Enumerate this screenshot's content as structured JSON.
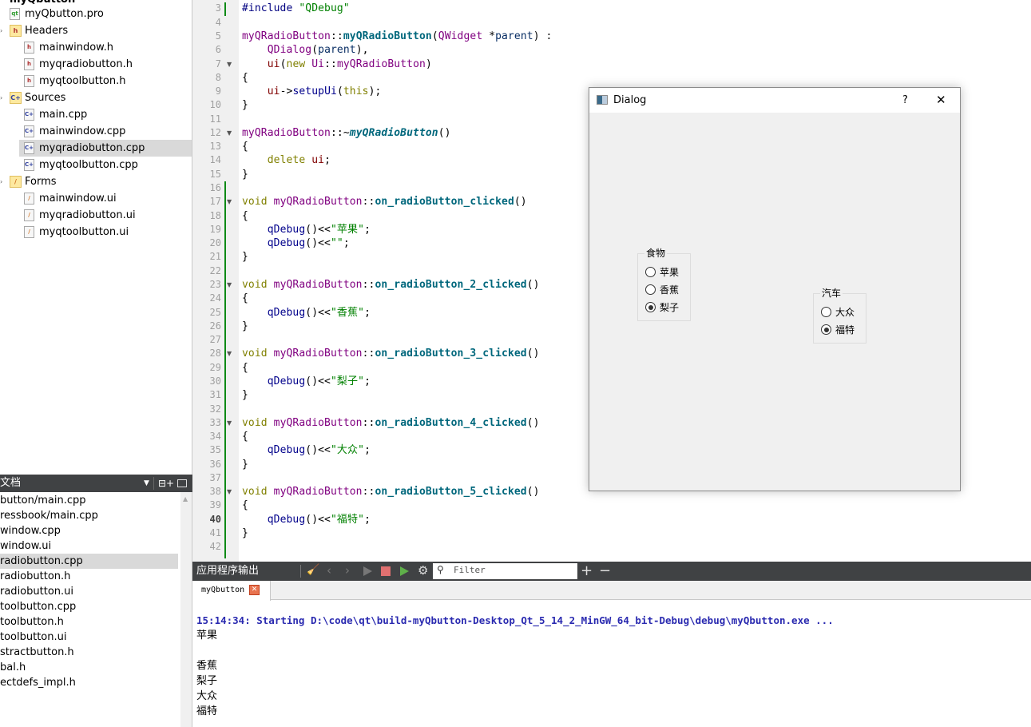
{
  "project_tree": {
    "root": "myQbutton",
    "items": [
      {
        "label": "myQbutton.pro",
        "icon": "qt-project-file-icon",
        "kind": "file",
        "badge": "qt"
      },
      {
        "label": "Headers",
        "icon": "headers-folder-icon",
        "kind": "folder",
        "badge": "h"
      },
      {
        "label": "mainwindow.h",
        "icon": "header-file-icon",
        "kind": "file",
        "badge": "h"
      },
      {
        "label": "myqradiobutton.h",
        "icon": "header-file-icon",
        "kind": "file",
        "badge": "h"
      },
      {
        "label": "myqtoolbutton.h",
        "icon": "header-file-icon",
        "kind": "file",
        "badge": "h"
      },
      {
        "label": "Sources",
        "icon": "sources-folder-icon",
        "kind": "folder",
        "badge": "C+"
      },
      {
        "label": "main.cpp",
        "icon": "cpp-file-icon",
        "kind": "file",
        "badge": "C+"
      },
      {
        "label": "mainwindow.cpp",
        "icon": "cpp-file-icon",
        "kind": "file",
        "badge": "C+"
      },
      {
        "label": "myqradiobutton.cpp",
        "icon": "cpp-file-icon",
        "kind": "file",
        "badge": "C+",
        "selected": true
      },
      {
        "label": "myqtoolbutton.cpp",
        "icon": "cpp-file-icon",
        "kind": "file",
        "badge": "C+"
      },
      {
        "label": "Forms",
        "icon": "forms-folder-icon",
        "kind": "folder",
        "badge": "/"
      },
      {
        "label": "mainwindow.ui",
        "icon": "ui-file-icon",
        "kind": "file",
        "badge": "/"
      },
      {
        "label": "myqradiobutton.ui",
        "icon": "ui-file-icon",
        "kind": "file",
        "badge": "/"
      },
      {
        "label": "myqtoolbutton.ui",
        "icon": "ui-file-icon",
        "kind": "file",
        "badge": "/"
      }
    ]
  },
  "open_documents": {
    "title": "文档",
    "items": [
      "button/main.cpp",
      "ressbook/main.cpp",
      "window.cpp",
      "window.ui",
      "radiobutton.cpp",
      "radiobutton.h",
      "radiobutton.ui",
      "toolbutton.cpp",
      "toolbutton.h",
      "toolbutton.ui",
      "stractbutton.h",
      "bal.h",
      "ectdefs_impl.h"
    ],
    "selected_index": 4
  },
  "editor": {
    "current_line": 40,
    "lines": [
      {
        "n": 3,
        "seg": [
          [
            "pp",
            "#include "
          ],
          [
            "str",
            "\"QDebug\""
          ]
        ]
      },
      {
        "n": 4,
        "seg": []
      },
      {
        "n": 5,
        "seg": [
          [
            "cls",
            "myQRadioButton"
          ],
          [
            "op",
            "::"
          ],
          [
            "fnb",
            "myQRadioButton"
          ],
          [
            "op",
            "("
          ],
          [
            "cls",
            "QWidget"
          ],
          [
            "op",
            " *"
          ],
          [
            "param",
            "parent"
          ],
          [
            "op",
            ") :"
          ]
        ]
      },
      {
        "n": 6,
        "seg": [
          [
            "op",
            "    "
          ],
          [
            "cls",
            "QDialog"
          ],
          [
            "op",
            "("
          ],
          [
            "param",
            "parent"
          ],
          [
            "op",
            "),"
          ]
        ]
      },
      {
        "n": 7,
        "fold": true,
        "seg": [
          [
            "op",
            "    "
          ],
          [
            "mem",
            "ui"
          ],
          [
            "op",
            "("
          ],
          [
            "kw",
            "new "
          ],
          [
            "cls",
            "Ui"
          ],
          [
            "op",
            "::"
          ],
          [
            "cls",
            "myQRadioButton"
          ],
          [
            "op",
            ")"
          ]
        ]
      },
      {
        "n": 8,
        "seg": [
          [
            "op",
            "{"
          ]
        ]
      },
      {
        "n": 9,
        "seg": [
          [
            "op",
            "    "
          ],
          [
            "mem",
            "ui"
          ],
          [
            "op",
            "->"
          ],
          [
            "fn",
            "setupUi"
          ],
          [
            "op",
            "("
          ],
          [
            "kw",
            "this"
          ],
          [
            "op",
            ");"
          ]
        ]
      },
      {
        "n": 10,
        "seg": [
          [
            "op",
            "}"
          ]
        ]
      },
      {
        "n": 11,
        "seg": []
      },
      {
        "n": 12,
        "fold": true,
        "seg": [
          [
            "cls",
            "myQRadioButton"
          ],
          [
            "op",
            "::~"
          ],
          [
            "fnbi",
            "myQRadioButton"
          ],
          [
            "op",
            "()"
          ]
        ]
      },
      {
        "n": 13,
        "seg": [
          [
            "op",
            "{"
          ]
        ]
      },
      {
        "n": 14,
        "seg": [
          [
            "op",
            "    "
          ],
          [
            "kw",
            "delete "
          ],
          [
            "mem",
            "ui"
          ],
          [
            "op",
            ";"
          ]
        ]
      },
      {
        "n": 15,
        "seg": [
          [
            "op",
            "}"
          ]
        ]
      },
      {
        "n": 16,
        "seg": []
      },
      {
        "n": 17,
        "fold": true,
        "seg": [
          [
            "kw",
            "void "
          ],
          [
            "cls",
            "myQRadioButton"
          ],
          [
            "op",
            "::"
          ],
          [
            "fnb",
            "on_radioButton_clicked"
          ],
          [
            "op",
            "()"
          ]
        ]
      },
      {
        "n": 18,
        "seg": [
          [
            "op",
            "{"
          ]
        ]
      },
      {
        "n": 19,
        "seg": [
          [
            "op",
            "    "
          ],
          [
            "fn",
            "qDebug"
          ],
          [
            "op",
            "()<<"
          ],
          [
            "str",
            "\"苹果\""
          ],
          [
            "op",
            ";"
          ]
        ]
      },
      {
        "n": 20,
        "seg": [
          [
            "op",
            "    "
          ],
          [
            "fn",
            "qDebug"
          ],
          [
            "op",
            "()<<"
          ],
          [
            "str",
            "\"\""
          ],
          [
            "op",
            ";"
          ]
        ]
      },
      {
        "n": 21,
        "seg": [
          [
            "op",
            "}"
          ]
        ]
      },
      {
        "n": 22,
        "seg": []
      },
      {
        "n": 23,
        "fold": true,
        "seg": [
          [
            "kw",
            "void "
          ],
          [
            "cls",
            "myQRadioButton"
          ],
          [
            "op",
            "::"
          ],
          [
            "fnb",
            "on_radioButton_2_clicked"
          ],
          [
            "op",
            "()"
          ]
        ]
      },
      {
        "n": 24,
        "seg": [
          [
            "op",
            "{"
          ]
        ]
      },
      {
        "n": 25,
        "seg": [
          [
            "op",
            "    "
          ],
          [
            "fn",
            "qDebug"
          ],
          [
            "op",
            "()<<"
          ],
          [
            "str",
            "\"香蕉\""
          ],
          [
            "op",
            ";"
          ]
        ]
      },
      {
        "n": 26,
        "seg": [
          [
            "op",
            "}"
          ]
        ]
      },
      {
        "n": 27,
        "seg": []
      },
      {
        "n": 28,
        "fold": true,
        "seg": [
          [
            "kw",
            "void "
          ],
          [
            "cls",
            "myQRadioButton"
          ],
          [
            "op",
            "::"
          ],
          [
            "fnb",
            "on_radioButton_3_clicked"
          ],
          [
            "op",
            "()"
          ]
        ]
      },
      {
        "n": 29,
        "seg": [
          [
            "op",
            "{"
          ]
        ]
      },
      {
        "n": 30,
        "seg": [
          [
            "op",
            "    "
          ],
          [
            "fn",
            "qDebug"
          ],
          [
            "op",
            "()<<"
          ],
          [
            "str",
            "\"梨子\""
          ],
          [
            "op",
            ";"
          ]
        ]
      },
      {
        "n": 31,
        "seg": [
          [
            "op",
            "}"
          ]
        ]
      },
      {
        "n": 32,
        "seg": []
      },
      {
        "n": 33,
        "fold": true,
        "seg": [
          [
            "kw",
            "void "
          ],
          [
            "cls",
            "myQRadioButton"
          ],
          [
            "op",
            "::"
          ],
          [
            "fnb",
            "on_radioButton_4_clicked"
          ],
          [
            "op",
            "()"
          ]
        ]
      },
      {
        "n": 34,
        "seg": [
          [
            "op",
            "{"
          ]
        ]
      },
      {
        "n": 35,
        "seg": [
          [
            "op",
            "    "
          ],
          [
            "fn",
            "qDebug"
          ],
          [
            "op",
            "()<<"
          ],
          [
            "str",
            "\"大众\""
          ],
          [
            "op",
            ";"
          ]
        ]
      },
      {
        "n": 36,
        "seg": [
          [
            "op",
            "}"
          ]
        ]
      },
      {
        "n": 37,
        "seg": []
      },
      {
        "n": 38,
        "fold": true,
        "seg": [
          [
            "kw",
            "void "
          ],
          [
            "cls",
            "myQRadioButton"
          ],
          [
            "op",
            "::"
          ],
          [
            "fnb",
            "on_radioButton_5_clicked"
          ],
          [
            "op",
            "()"
          ]
        ]
      },
      {
        "n": 39,
        "seg": [
          [
            "op",
            "{"
          ]
        ]
      },
      {
        "n": 40,
        "seg": [
          [
            "op",
            "    "
          ],
          [
            "fn",
            "qDebug"
          ],
          [
            "op",
            "()<<"
          ],
          [
            "str",
            "\"福特\""
          ],
          [
            "op",
            ";"
          ]
        ]
      },
      {
        "n": 41,
        "seg": [
          [
            "op",
            "}"
          ]
        ]
      },
      {
        "n": 42,
        "seg": []
      }
    ]
  },
  "output_pane": {
    "title": "应用程序输出",
    "filter_placeholder": "Filter",
    "tab_label": "myQbutton",
    "lines": [
      "15:14:34: Starting D:\\code\\qt\\build-myQbutton-Desktop_Qt_5_14_2_MinGW_64_bit-Debug\\debug\\myQbutton.exe ...",
      "苹果",
      "",
      "香蕉",
      "梨子",
      "大众",
      "福特"
    ]
  },
  "dialog": {
    "title": "Dialog",
    "help_label": "?",
    "close_label": "✕",
    "groups": [
      {
        "title": "食物",
        "options": [
          {
            "label": "苹果",
            "checked": false
          },
          {
            "label": "香蕉",
            "checked": false
          },
          {
            "label": "梨子",
            "checked": true
          }
        ]
      },
      {
        "title": "汽车",
        "options": [
          {
            "label": "大众",
            "checked": false
          },
          {
            "label": "福特",
            "checked": true
          }
        ]
      }
    ]
  },
  "colors": {
    "dark_panel": "#404244",
    "change_bar": "#0e8a16",
    "stop_button": "#e07070",
    "selection": "#d9d9d9"
  }
}
